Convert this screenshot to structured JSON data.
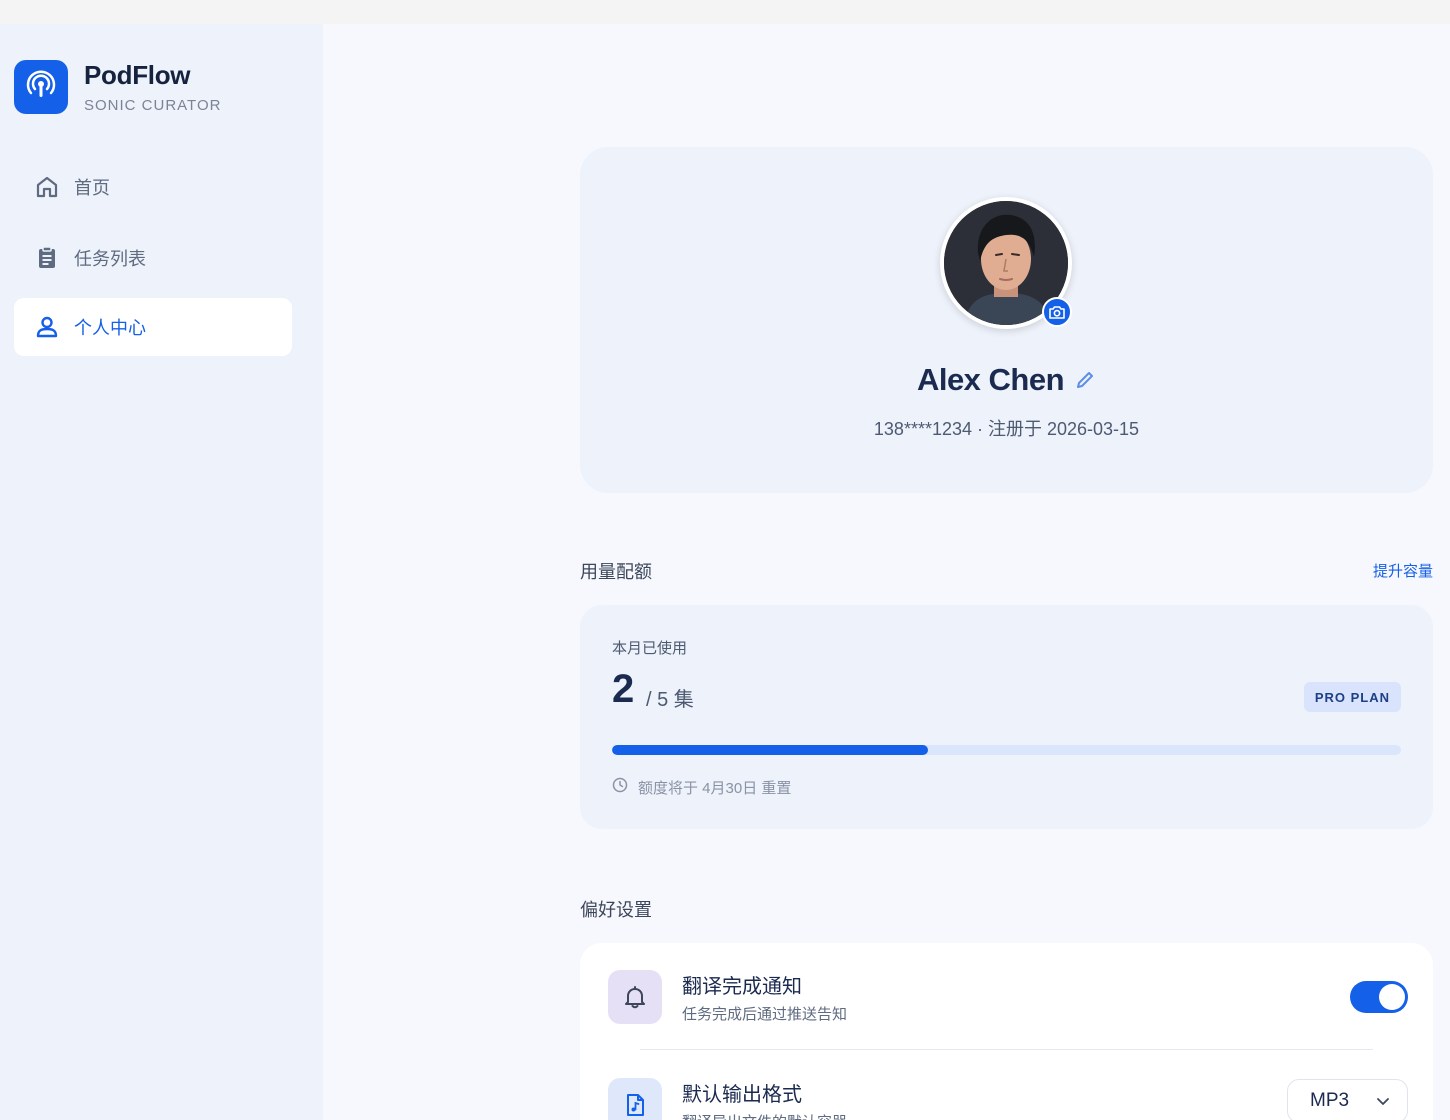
{
  "brand": {
    "name": "PodFlow",
    "tagline": "SONIC CURATOR",
    "logo_icon": "podcast-icon"
  },
  "sidebar": {
    "items": [
      {
        "label": "首页",
        "icon": "home-icon",
        "active": false
      },
      {
        "label": "任务列表",
        "icon": "clipboard-icon",
        "active": false
      },
      {
        "label": "个人中心",
        "icon": "user-icon",
        "active": true
      }
    ]
  },
  "profile": {
    "name": "Alex Chen",
    "meta": "138****1234 · 注册于 2026-03-15",
    "avatar_icon": "avatar-portrait",
    "camera_icon": "camera-icon",
    "edit_icon": "pencil-icon"
  },
  "quota": {
    "section_title": "用量配额",
    "upgrade_link": "提升容量",
    "label": "本月已使用",
    "used": "2",
    "total_text": "/ 5 集",
    "plan_badge": "PRO PLAN",
    "progress_fraction": 0.4,
    "reset_text": "额度将于 4月30日 重置",
    "reset_icon": "clock-icon"
  },
  "preferences": {
    "section_title": "偏好设置",
    "items": [
      {
        "title": "翻译完成通知",
        "desc": "任务完成后通过推送告知",
        "icon": "bell-icon",
        "control": "toggle",
        "enabled": true
      },
      {
        "title": "默认输出格式",
        "desc": "翻译导出文件的默认容器",
        "icon": "music-file-icon",
        "control": "select",
        "value": "MP3"
      }
    ]
  },
  "colors": {
    "accent": "#1560e8",
    "sidebar_bg": "#eef2fb",
    "main_bg": "#f7f8fd",
    "text_dark": "#1b2a4f",
    "bell_icon_bg": "#e6e0f6",
    "file_icon_bg": "#dfe8fb"
  }
}
